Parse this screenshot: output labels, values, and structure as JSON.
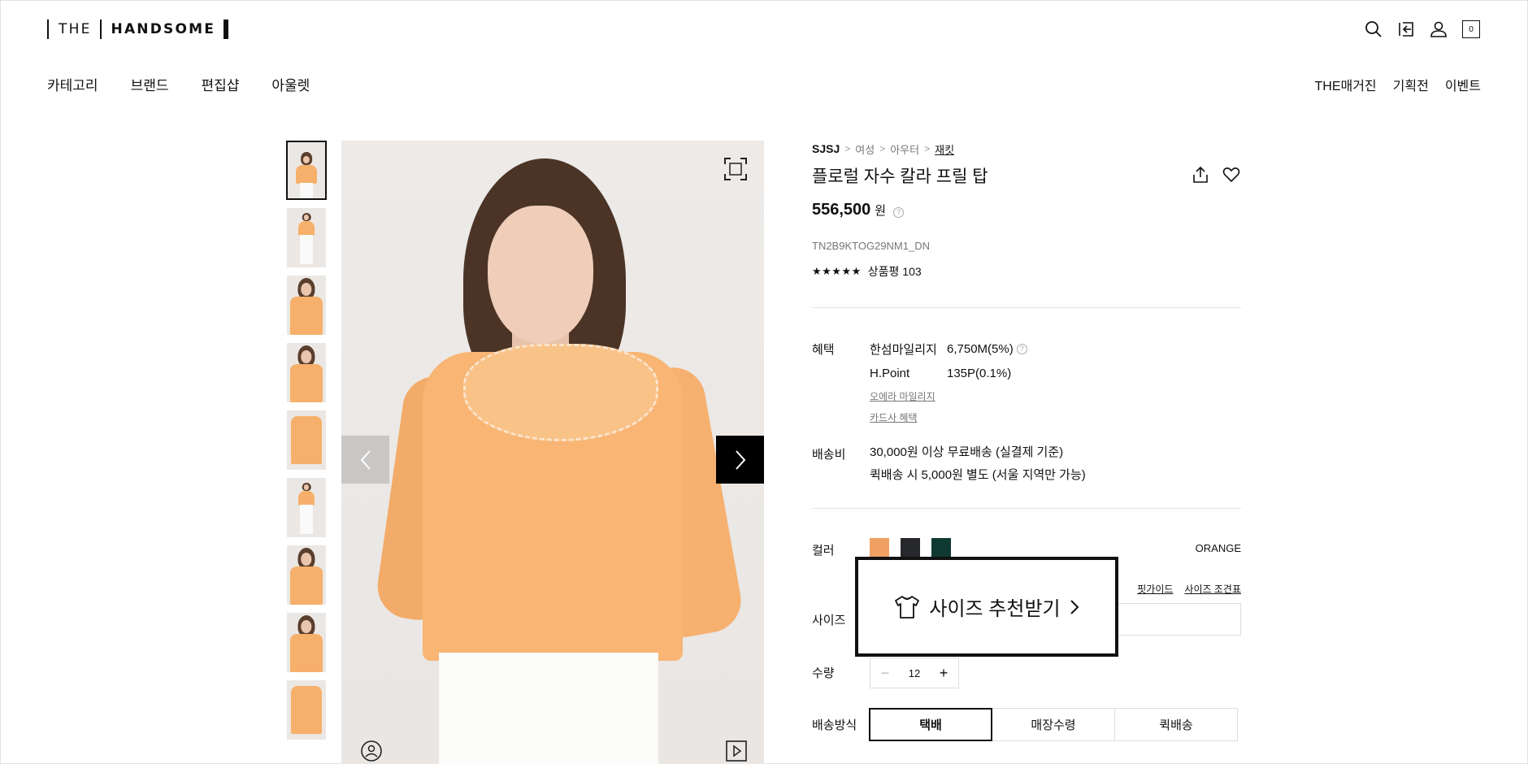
{
  "header": {
    "logo_left": "THE",
    "logo_right": "HANDSOME",
    "cart_count": "0",
    "icons": [
      "search-icon",
      "logout-icon",
      "user-icon",
      "cart-icon"
    ]
  },
  "nav": {
    "left": [
      "카테고리",
      "브랜드",
      "편집샵",
      "아울렛"
    ],
    "right": [
      "THE매거진",
      "기획전",
      "이벤트"
    ]
  },
  "gallery": {
    "thumbnail_count": 9,
    "active_index": 0
  },
  "product": {
    "breadcrumb": [
      "SJSJ",
      "여성",
      "아우터",
      "재킷"
    ],
    "name": "플로럴 자수 칼라 프릴 탑",
    "price": "556,500",
    "currency": "원",
    "code": "TN2B9KTOG29NM1_DN",
    "stars": "★★★★★",
    "review_label": "상품평 103"
  },
  "benefit": {
    "label": "혜택",
    "mileage_label": "한섬마일리지",
    "mileage_value": "6,750M(5%)",
    "hpoint_label": "H.Point",
    "hpoint_value": "135P(0.1%)",
    "link1": "오에라 마일리지",
    "link2": "카드사 혜택"
  },
  "shipping": {
    "label": "배송비",
    "line1": "30,000원 이상 무료배송 (실결제 기준)",
    "line2": "퀵배송 시 5,000원 별도 (서울 지역만 가능)"
  },
  "color": {
    "label": "컬러",
    "selected": "ORANGE",
    "swatches": [
      "#f0a063",
      "#26282b",
      "#0f3a32"
    ]
  },
  "size": {
    "label": "사이즈",
    "fit_guide": "핏가이드",
    "size_chart": "사이즈 조견표"
  },
  "quantity": {
    "label": "수량",
    "value": "12"
  },
  "delivery": {
    "label": "배송방식",
    "options": [
      "택배",
      "매장수령",
      "퀵배송"
    ],
    "selected": "택배"
  },
  "popup": {
    "text": "사이즈 추천받기"
  }
}
